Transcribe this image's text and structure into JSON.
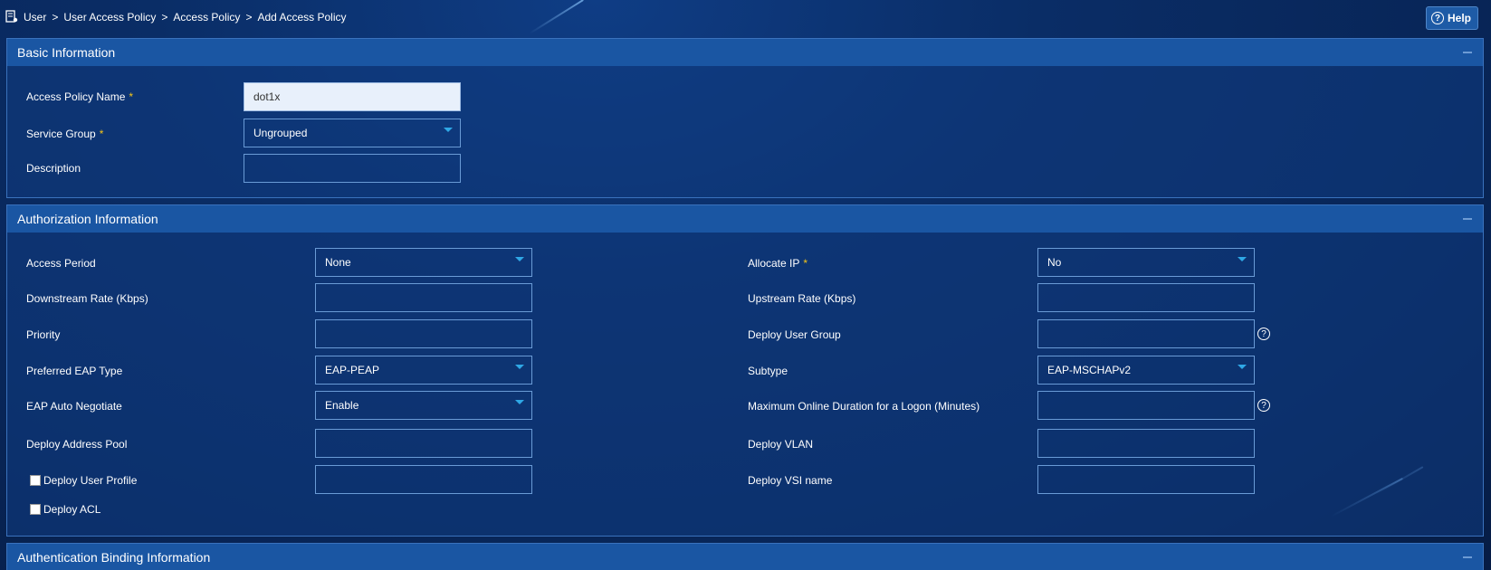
{
  "breadcrumb": {
    "items": [
      "User",
      "User Access Policy",
      "Access Policy",
      "Add Access Policy"
    ],
    "separator": ">"
  },
  "help": {
    "label": "Help"
  },
  "basic": {
    "title": "Basic Information",
    "policy_name": {
      "label": "Access Policy Name",
      "required": "*",
      "value": "dot1x"
    },
    "service_group": {
      "label": "Service Group",
      "required": "*",
      "value": "Ungrouped"
    },
    "description": {
      "label": "Description",
      "value": ""
    }
  },
  "authorization": {
    "title": "Authorization Information",
    "access_period": {
      "label": "Access Period",
      "value": "None"
    },
    "downstream_rate": {
      "label": "Downstream Rate (Kbps)",
      "value": ""
    },
    "priority": {
      "label": "Priority",
      "value": ""
    },
    "preferred_eap": {
      "label": "Preferred EAP Type",
      "value": "EAP-PEAP"
    },
    "eap_auto": {
      "label": "EAP Auto Negotiate",
      "value": "Enable"
    },
    "address_pool": {
      "label": "Deploy Address Pool",
      "value": ""
    },
    "user_profile": {
      "label": "Deploy User Profile",
      "value": ""
    },
    "acl": {
      "label": "Deploy ACL"
    },
    "allocate_ip": {
      "label": "Allocate IP",
      "required": "*",
      "value": "No"
    },
    "upstream_rate": {
      "label": "Upstream Rate (Kbps)",
      "value": ""
    },
    "user_group": {
      "label": "Deploy User Group",
      "value": ""
    },
    "subtype": {
      "label": "Subtype",
      "value": "EAP-MSCHAPv2"
    },
    "max_online": {
      "label": "Maximum Online Duration for a Logon (Minutes)",
      "value": ""
    },
    "vlan": {
      "label": "Deploy VLAN",
      "value": ""
    },
    "vsi": {
      "label": "Deploy VSI name",
      "value": ""
    }
  },
  "binding": {
    "title": "Authentication Binding Information"
  },
  "colors": {
    "background": "#082557",
    "panel_header": "#1a56a3",
    "border": "#6a9bd6",
    "required": "#f5c518",
    "caret": "#2fa8e6"
  }
}
